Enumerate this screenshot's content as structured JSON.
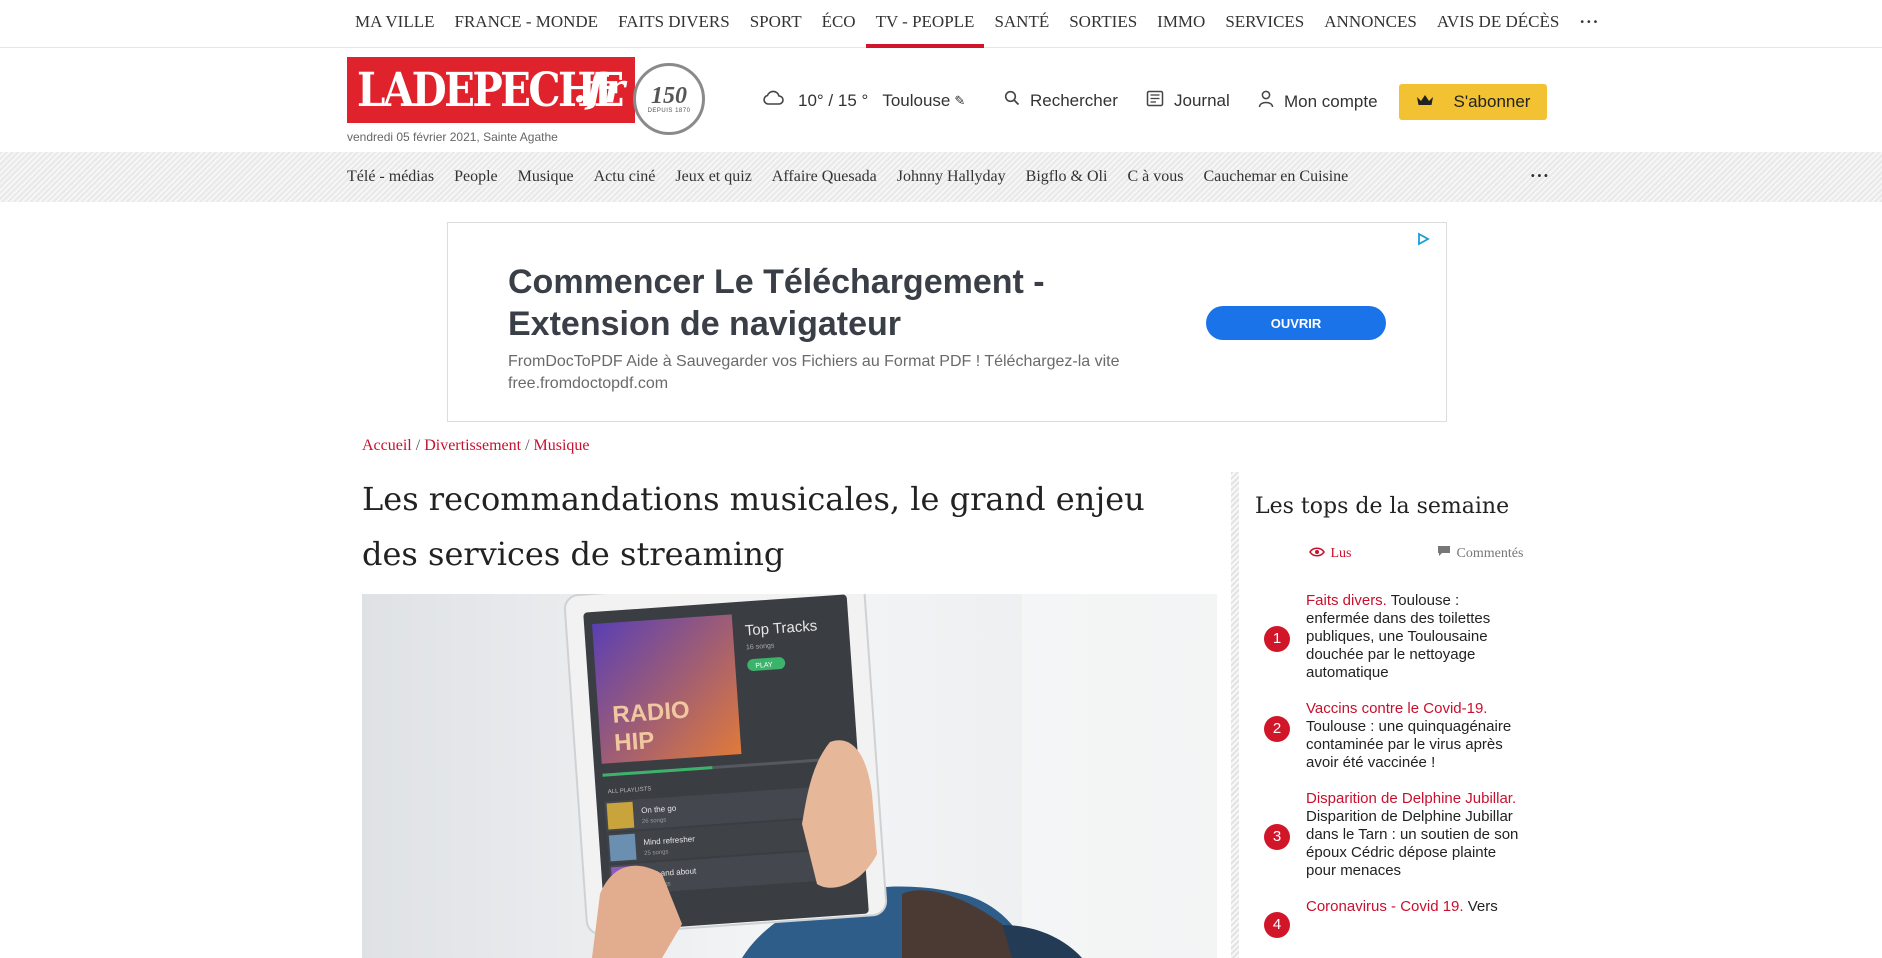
{
  "topnav": {
    "items": [
      "MA VILLE",
      "FRANCE - MONDE",
      "FAITS DIVERS",
      "SPORT",
      "ÉCO",
      "TV - PEOPLE",
      "SANTÉ",
      "SORTIES",
      "IMMO",
      "SERVICES",
      "ANNONCES",
      "AVIS DE DÉCÈS"
    ],
    "active": "TV - PEOPLE",
    "more": "···",
    "accent": "#d2162a"
  },
  "header": {
    "logo_text": "LADEPECHE",
    "logo_tld": ".fr",
    "seal_number": "150",
    "seal_text": "L'INFO QUI NOUS UNIT · DEPUIS 1870",
    "date": "vendredi 05 février 2021, Sainte Agathe",
    "weather": {
      "temp": "10° / 15 °",
      "city": "Toulouse",
      "icon": "cloud-icon"
    },
    "search_label": "Rechercher",
    "journal_label": "Journal",
    "account_label": "Mon compte",
    "subscribe_label": "S'abonner",
    "brand_color": "#e0222c",
    "subscribe_color": "#f2c232"
  },
  "subnav": {
    "items": [
      "Télé - médias",
      "People",
      "Musique",
      "Actu ciné",
      "Jeux et quiz",
      "Affaire Quesada",
      "Johnny Hallyday",
      "Bigflo & Oli",
      "C à vous",
      "Cauchemar en Cuisine"
    ],
    "more": "···"
  },
  "ad": {
    "headline": "Commencer Le Téléchargement - Extension de navigateur",
    "description": "FromDocToPDF Aide à Sauvegarder vos Fichiers au Format PDF ! Téléchargez-la vite",
    "url": "free.fromdoctopdf.com",
    "cta": "OUVRIR",
    "cta_color": "#1a73e8"
  },
  "breadcrumb": [
    "Accueil",
    "Divertissement",
    "Musique"
  ],
  "article": {
    "title": "Les recommandations musicales, le grand enjeu des services de streaming",
    "image": {
      "tablet_heading": "Top Tracks",
      "tablet_sub": "16 songs",
      "play": "PLAY",
      "album_text": "RADIO HIP",
      "playlists_label": "ALL PLAYLISTS",
      "playlists": [
        "On the go",
        "Mind refresher",
        "Out and about"
      ],
      "playlist_counts": [
        "26 songs",
        "25 songs",
        "12 songs"
      ]
    }
  },
  "sidebar": {
    "title": "Les tops de la semaine",
    "tab_read": "Lus",
    "tab_comments": "Commentés",
    "items": [
      {
        "num": "1",
        "category": "Faits divers.",
        "text": " Toulouse : enfermée dans des toilettes publiques, une Toulousaine douchée par le nettoyage automatique"
      },
      {
        "num": "2",
        "category": "Vaccins contre le Covid-19.",
        "text": " Toulouse : une quinquagénaire contaminée par le virus après avoir été vaccinée !"
      },
      {
        "num": "3",
        "category": "Disparition de Delphine Jubillar.",
        "text": " Disparition de Delphine Jubillar dans le Tarn : un soutien de son époux Cédric dépose plainte pour menaces"
      },
      {
        "num": "4",
        "category": "Coronavirus - Covid 19.",
        "text": " Vers"
      }
    ]
  }
}
